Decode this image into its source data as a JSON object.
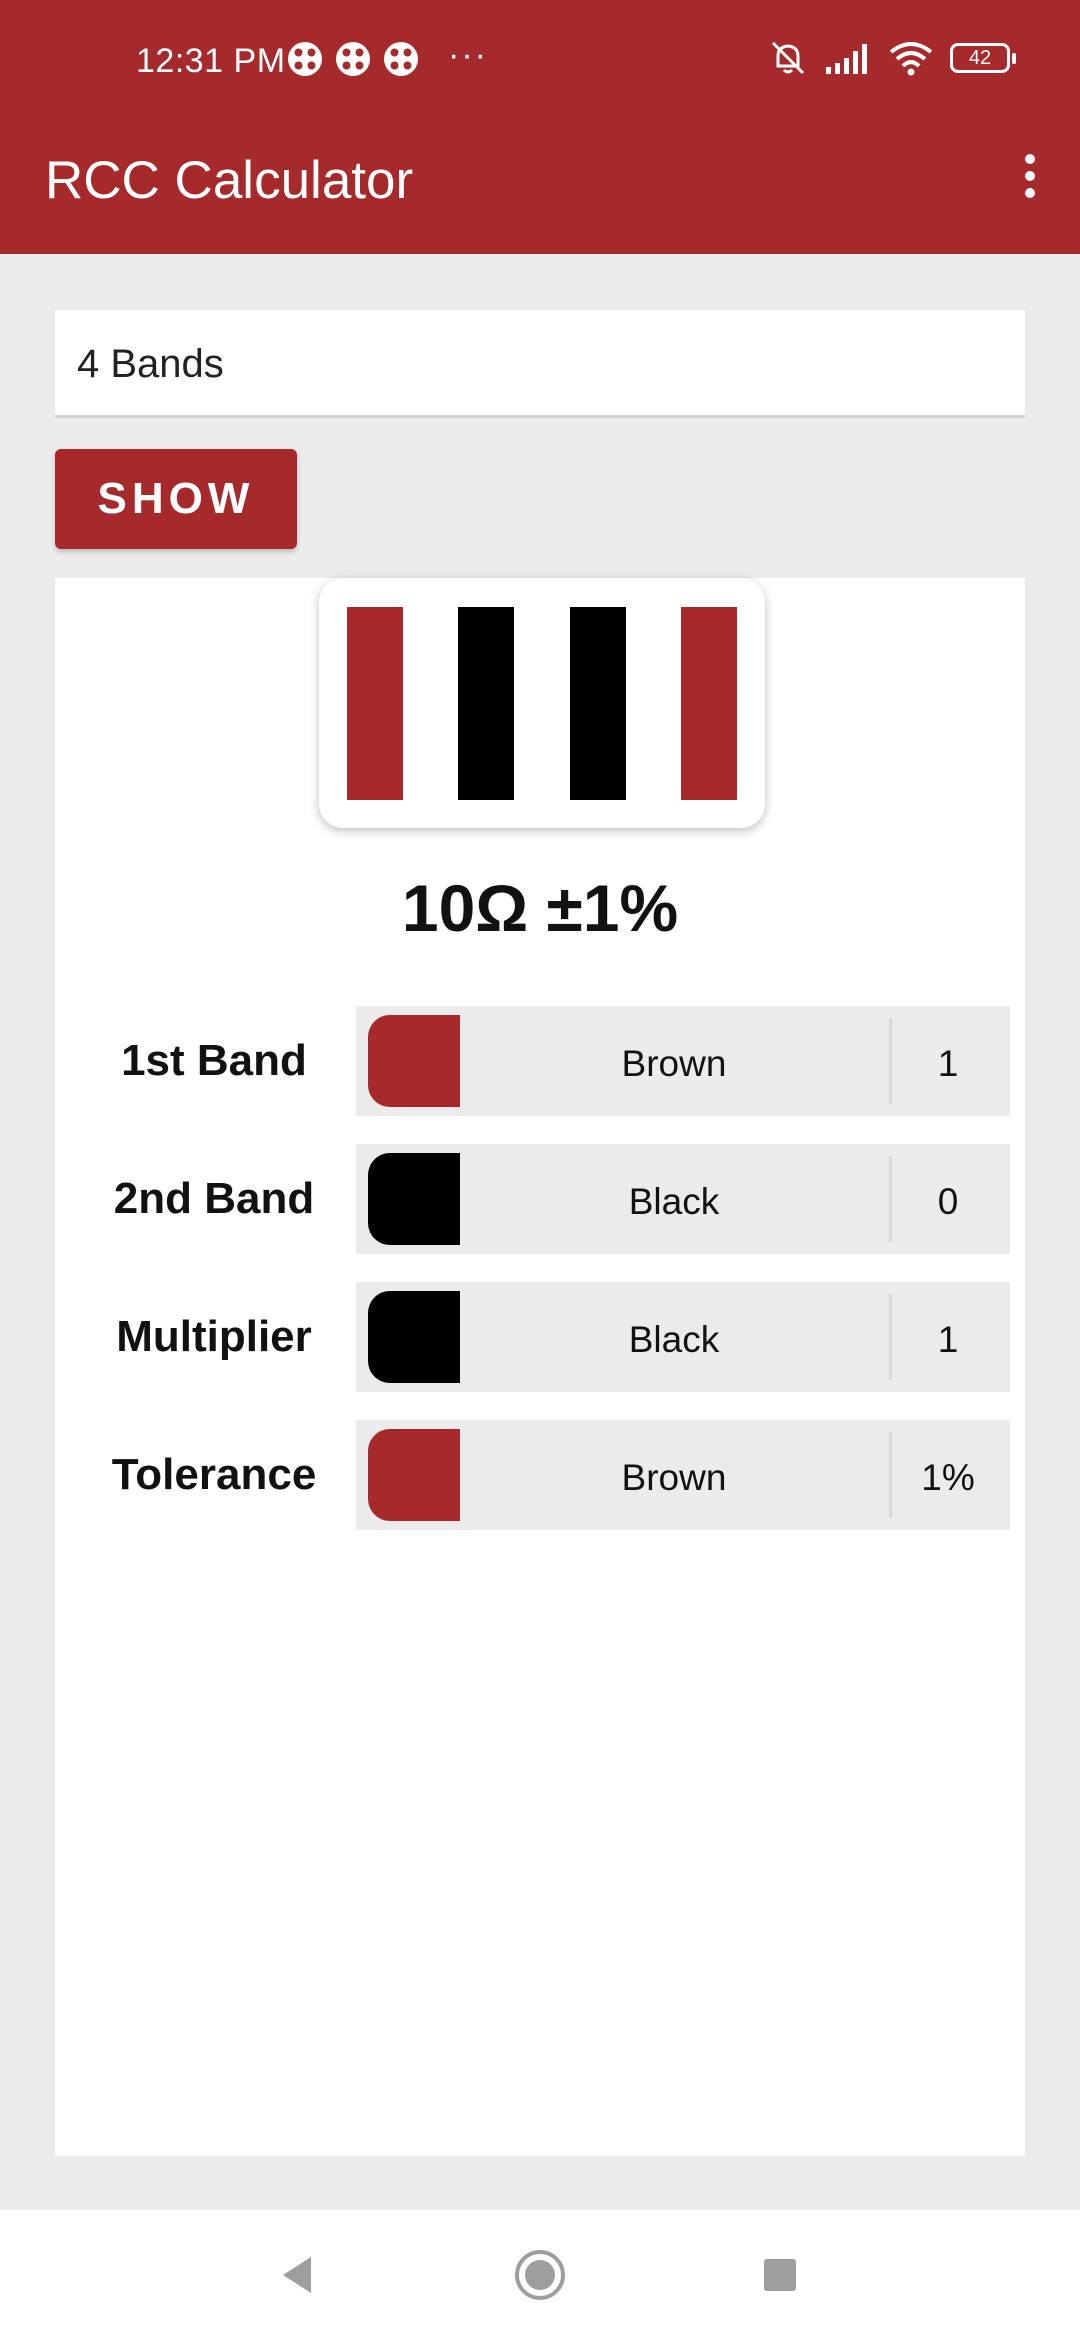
{
  "status_bar": {
    "time": "12:31 PM",
    "more": "···",
    "battery": "42"
  },
  "app_bar": {
    "title": "RCC Calculator"
  },
  "band_mode": {
    "selected": "4 Bands"
  },
  "show_button": {
    "label": "SHOW"
  },
  "resistor": {
    "bands": [
      "#a6292b",
      "#000000",
      "#000000",
      "#a6292b"
    ]
  },
  "result": "10Ω ±1%",
  "rows": [
    {
      "label": "1st Band",
      "color_name": "Brown",
      "value": "1",
      "color": "#a6292b"
    },
    {
      "label": "2nd Band",
      "color_name": "Black",
      "value": "0",
      "color": "#000000"
    },
    {
      "label": "Multiplier",
      "color_name": "Black",
      "value": "1",
      "color": "#000000"
    },
    {
      "label": "Tolerance",
      "color_name": "Brown",
      "value": "1%",
      "color": "#a6292b"
    }
  ],
  "colors": {
    "primary": "#a6292b",
    "background": "#ebebeb",
    "surface": "#ffffff"
  },
  "icons": {
    "notifications": [
      "notification-icon",
      "notification-icon",
      "notification-icon"
    ],
    "status": [
      "mute-icon",
      "signal-icon",
      "wifi-icon",
      "battery-icon"
    ],
    "nav": [
      "back-icon",
      "home-icon",
      "recents-icon"
    ]
  }
}
